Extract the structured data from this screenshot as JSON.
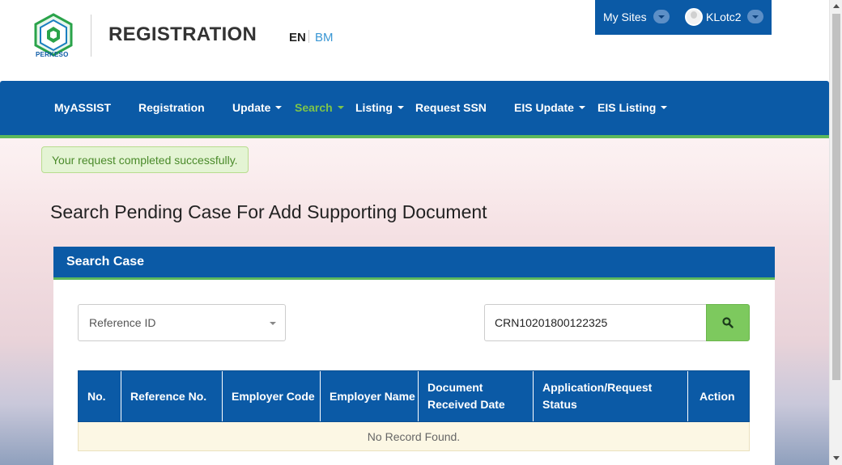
{
  "header": {
    "logo_text": "PERKESO",
    "app_title": "REGISTRATION",
    "lang_en": "EN",
    "lang_bm": "BM"
  },
  "user_bar": {
    "my_sites": "My Sites",
    "username": "KLotc2"
  },
  "nav": {
    "items": [
      {
        "label": "MyASSIST",
        "has_dropdown": false,
        "active": false
      },
      {
        "label": "Registration",
        "has_dropdown": false,
        "active": false
      },
      {
        "label": "Update",
        "has_dropdown": true,
        "active": false
      },
      {
        "label": "Search",
        "has_dropdown": true,
        "active": true
      },
      {
        "label": "Listing",
        "has_dropdown": true,
        "active": false
      },
      {
        "label": "Request SSN",
        "has_dropdown": false,
        "active": false
      },
      {
        "label": "EIS Update",
        "has_dropdown": true,
        "active": false
      },
      {
        "label": "EIS Listing",
        "has_dropdown": true,
        "active": false
      }
    ]
  },
  "alert": {
    "message": "Your request completed successfully."
  },
  "page_title": "Search Pending Case For Add Supporting Document",
  "panel": {
    "title": "Search Case",
    "select_value": "Reference ID",
    "search_value": "CRN10201800122325",
    "search_icon": "search-icon"
  },
  "table": {
    "headers": [
      "No.",
      "Reference No.",
      "Employer Code",
      "Employer Name",
      "Document Received Date",
      "Application/Request Status",
      "Action"
    ],
    "empty_message": "No Record Found."
  },
  "colors": {
    "primary": "#0b5aa6",
    "accent_green": "#5cb85c",
    "active_nav": "#7dc44a",
    "search_button": "#7dc95e"
  }
}
